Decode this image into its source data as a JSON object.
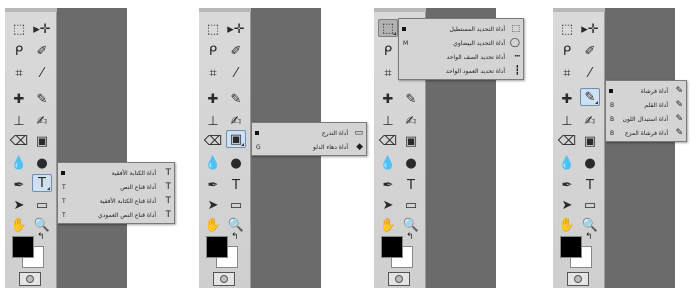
{
  "panels": [
    {
      "active_tool": "type",
      "flyout": {
        "items": [
          {
            "label": "أداة الكتابة الأفقية",
            "key": "",
            "icon": "T"
          },
          {
            "label": "أداة قناع النص",
            "key": "T",
            "icon": "T"
          },
          {
            "label": "أداة قناع الكتابة الأفقية",
            "key": "T",
            "icon": "T"
          },
          {
            "label": "أداة قناع النص العمودي",
            "key": "T",
            "icon": "T"
          }
        ]
      }
    },
    {
      "active_tool": "gradient",
      "flyout": {
        "items": [
          {
            "label": "أداة التدرج",
            "key": "",
            "icon": "▭"
          },
          {
            "label": "أداة دهاء الدلو",
            "key": "G",
            "icon": "◆"
          }
        ]
      }
    },
    {
      "active_tool": "marquee",
      "flyout": {
        "items": [
          {
            "label": "أداة التحديد المستطيل",
            "key": "",
            "icon": "⬚"
          },
          {
            "label": "أداة التحديد البيضاوي",
            "key": "M",
            "icon": "◯"
          },
          {
            "label": "أداة تحديد الصف الواحد",
            "key": "",
            "icon": "┅"
          },
          {
            "label": "أداة تحديد العمود الواحد",
            "key": "",
            "icon": "┇"
          }
        ]
      }
    },
    {
      "active_tool": "brush",
      "flyout": {
        "items": [
          {
            "label": "أداة فرشاة",
            "key": "",
            "icon": "✎"
          },
          {
            "label": "أداة القلم",
            "key": "B",
            "icon": "✎"
          },
          {
            "label": "أداة استبدال اللون",
            "key": "B",
            "icon": "✎"
          },
          {
            "label": "أداة فرشاة المزج",
            "key": "B",
            "icon": "✎"
          }
        ]
      }
    }
  ],
  "colors": {
    "panel_bg": "#6b6b6b",
    "toolbar_bg": "#d2d2d2",
    "foreground": "#000000",
    "background": "#ffffff"
  },
  "icons": [
    "marquee-icon",
    "move-icon",
    "lasso-icon",
    "quick-select-icon",
    "crop-icon",
    "eyedropper-icon",
    "healing-icon",
    "brush-icon",
    "stamp-icon",
    "history-brush-icon",
    "eraser-icon",
    "gradient-icon",
    "blur-icon",
    "dodge-icon",
    "pen-icon",
    "type-icon",
    "path-select-icon",
    "shape-icon",
    "hand-icon",
    "zoom-icon"
  ]
}
